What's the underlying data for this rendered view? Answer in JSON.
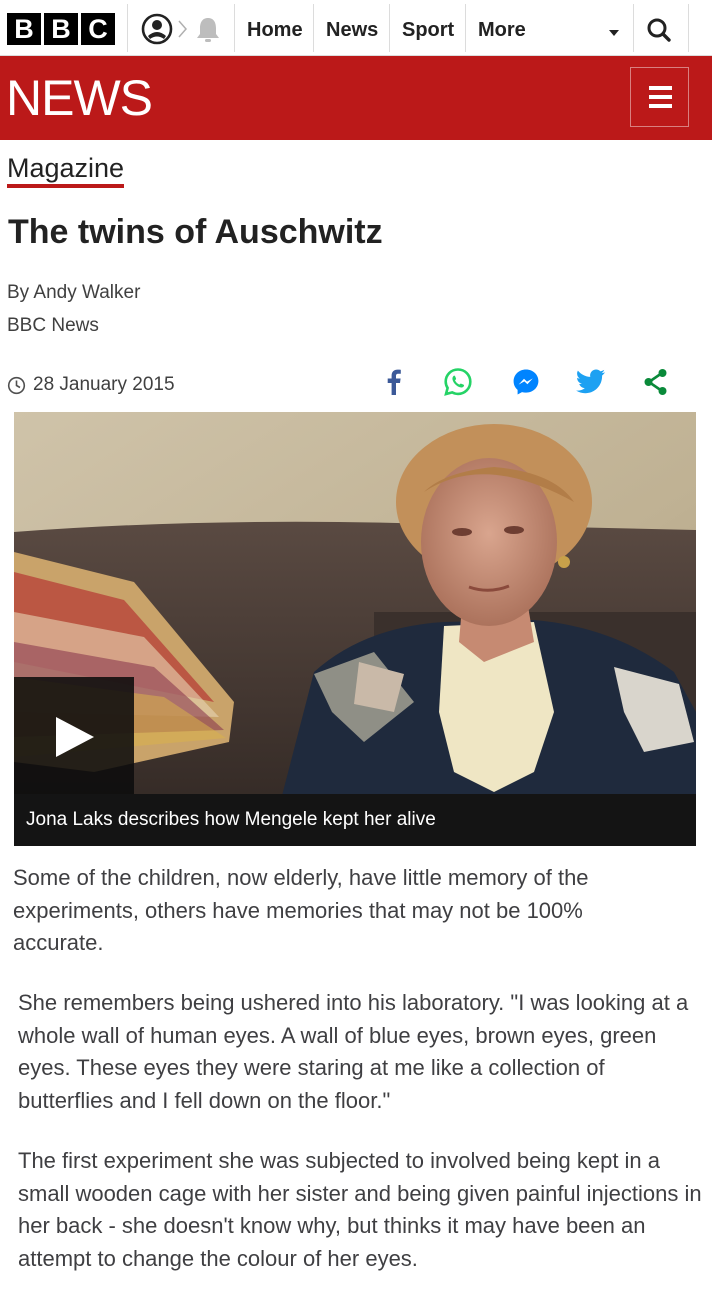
{
  "brand": {
    "letters": [
      "B",
      "B",
      "C"
    ],
    "banner_title": "NEWS",
    "accent_color": "#bb1919"
  },
  "topnav": {
    "items": [
      {
        "label": "Home"
      },
      {
        "label": "News"
      },
      {
        "label": "Sport"
      }
    ],
    "more_label": "More",
    "icons": [
      "account-icon",
      "notification-bell-icon",
      "search-icon",
      "hamburger-menu-icon"
    ]
  },
  "article": {
    "section": "Magazine",
    "title": "The twins of Auschwitz",
    "author": "By Andy Walker",
    "organisation": "BBC News",
    "date": "28 January 2015",
    "share_icons": [
      "facebook-icon",
      "whatsapp-icon",
      "messenger-icon",
      "twitter-icon",
      "share-icon"
    ],
    "share_colors": {
      "facebook": "#3b5998",
      "whatsapp": "#25d366",
      "messenger": "#0084ff",
      "twitter": "#1da1f2",
      "share": "#0a8a3a"
    },
    "media": {
      "caption": "Jona Laks describes how Mengele kept her alive",
      "play_icon": "play-icon"
    },
    "paragraphs": [
      "Some of the children, now elderly, have little memory of the experiments, others have memories that may not be 100% accurate.",
      "She remembers being ushered into his laboratory. \"I was looking at a whole wall of human eyes. A wall of blue eyes, brown eyes, green eyes. These eyes they were staring at me like a collection of butterflies and I fell down on the floor.\"",
      "The first experiment she was subjected to involved being kept in a small wooden cage with her sister and being given painful injections in her back - she doesn't know why, but thinks it may have been an attempt to change the colour of her eyes."
    ]
  }
}
